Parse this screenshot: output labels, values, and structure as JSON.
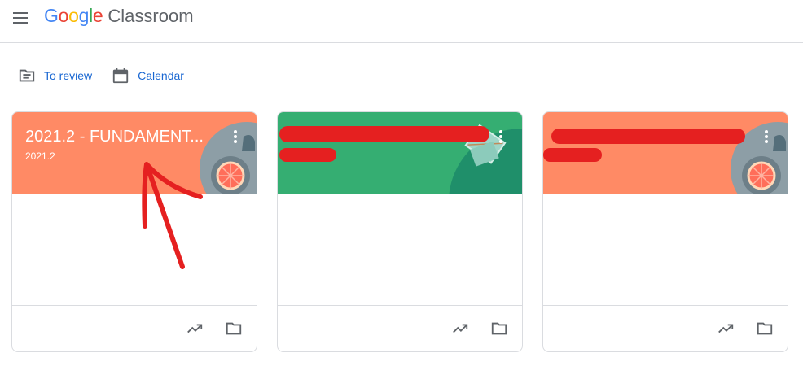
{
  "header": {
    "logo_google": [
      "G",
      "o",
      "o",
      "g",
      "l",
      "e"
    ],
    "logo_colors": [
      "#4285f4",
      "#ea4335",
      "#fbbc04",
      "#4285f4",
      "#34a853",
      "#ea4335"
    ],
    "product": "Classroom"
  },
  "subnav": {
    "to_review": "To review",
    "calendar": "Calendar"
  },
  "cards": [
    {
      "title": "2021.2 - FUNDAMENT...",
      "section": "2021.2",
      "theme": "#ff8a65"
    },
    {
      "title": "",
      "section": "",
      "theme": "#35ae72"
    },
    {
      "title": "",
      "section": "",
      "theme": "#ff8a65"
    }
  ],
  "colors": {
    "accent": "#1967d2",
    "redaction": "#e52020"
  }
}
